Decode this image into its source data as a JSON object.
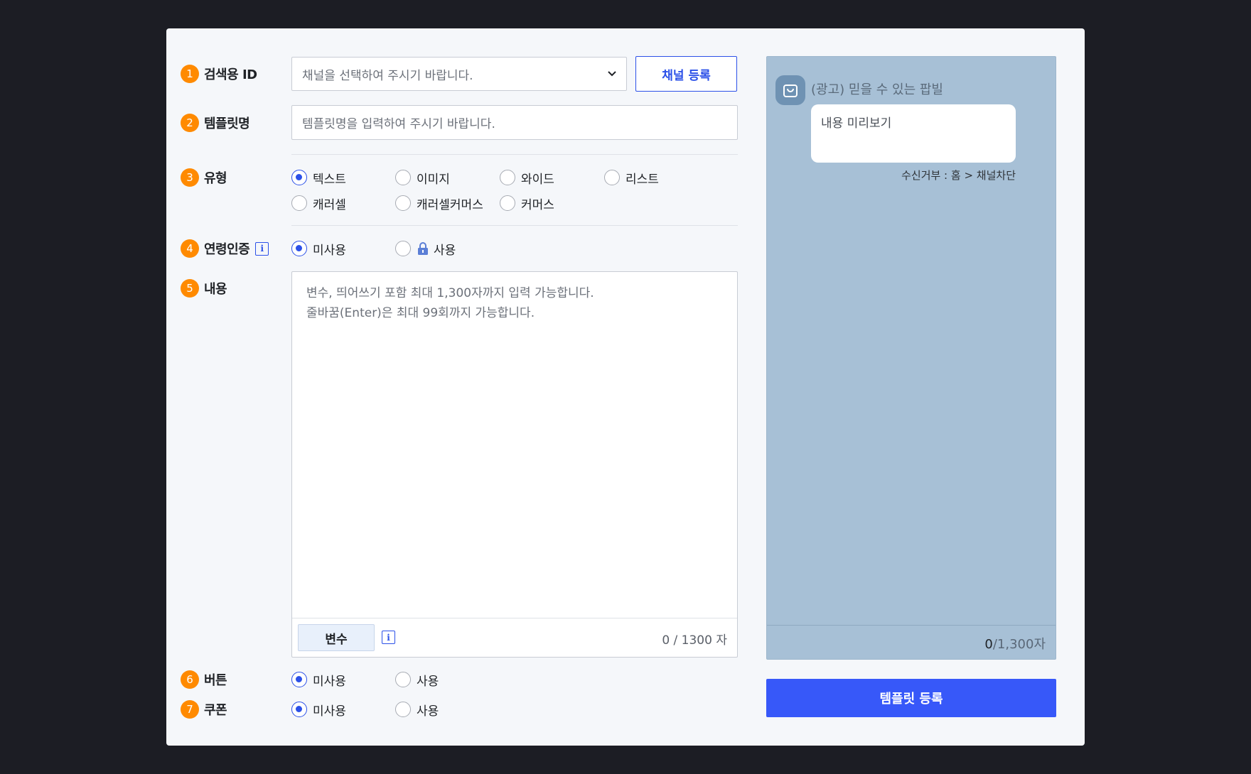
{
  "fields": {
    "search_id": {
      "num": "1",
      "label": "검색용 ID",
      "select_placeholder": "채널을 선택하여 주시기 바랍니다.",
      "register_button": "채널 등록"
    },
    "template_name": {
      "num": "2",
      "label": "템플릿명",
      "placeholder": "템플릿명을 입력하여 주시기 바랍니다."
    },
    "type": {
      "num": "3",
      "label": "유형",
      "options": [
        "텍스트",
        "이미지",
        "와이드",
        "리스트",
        "캐러셀",
        "캐러셀커머스",
        "커머스"
      ],
      "selected": "텍스트"
    },
    "age_auth": {
      "num": "4",
      "label": "연령인증",
      "info": "i",
      "options": [
        "미사용",
        "사용"
      ],
      "selected": "미사용"
    },
    "content": {
      "num": "5",
      "label": "내용",
      "placeholder_line1": "변수, 띄어쓰기 포함 최대 1,300자까지 입력 가능합니다.",
      "placeholder_line2": "줄바꿈(Enter)은 최대 99회까지 가능합니다.",
      "variable_button": "변수",
      "info": "i",
      "counter": "0 / 1300 자"
    },
    "button": {
      "num": "6",
      "label": "버튼",
      "options": [
        "미사용",
        "사용"
      ],
      "selected": "미사용"
    },
    "coupon": {
      "num": "7",
      "label": "쿠폰",
      "options": [
        "미사용",
        "사용"
      ],
      "selected": "미사용"
    }
  },
  "preview": {
    "sender": "(광고) 믿을 수 있는 팝빌",
    "bubble_text": "내용 미리보기",
    "optout": "수신거부 : 홈 > 채널차단",
    "count_current": "0",
    "count_max": "/1,300자",
    "icon": "shopping-bag-icon"
  },
  "submit_button": "템플릿 등록",
  "colors": {
    "accent": "#2b50e8",
    "primary_button": "#3758f9",
    "badge": "#ff8a00",
    "preview_bg": "#a7c0d6"
  }
}
